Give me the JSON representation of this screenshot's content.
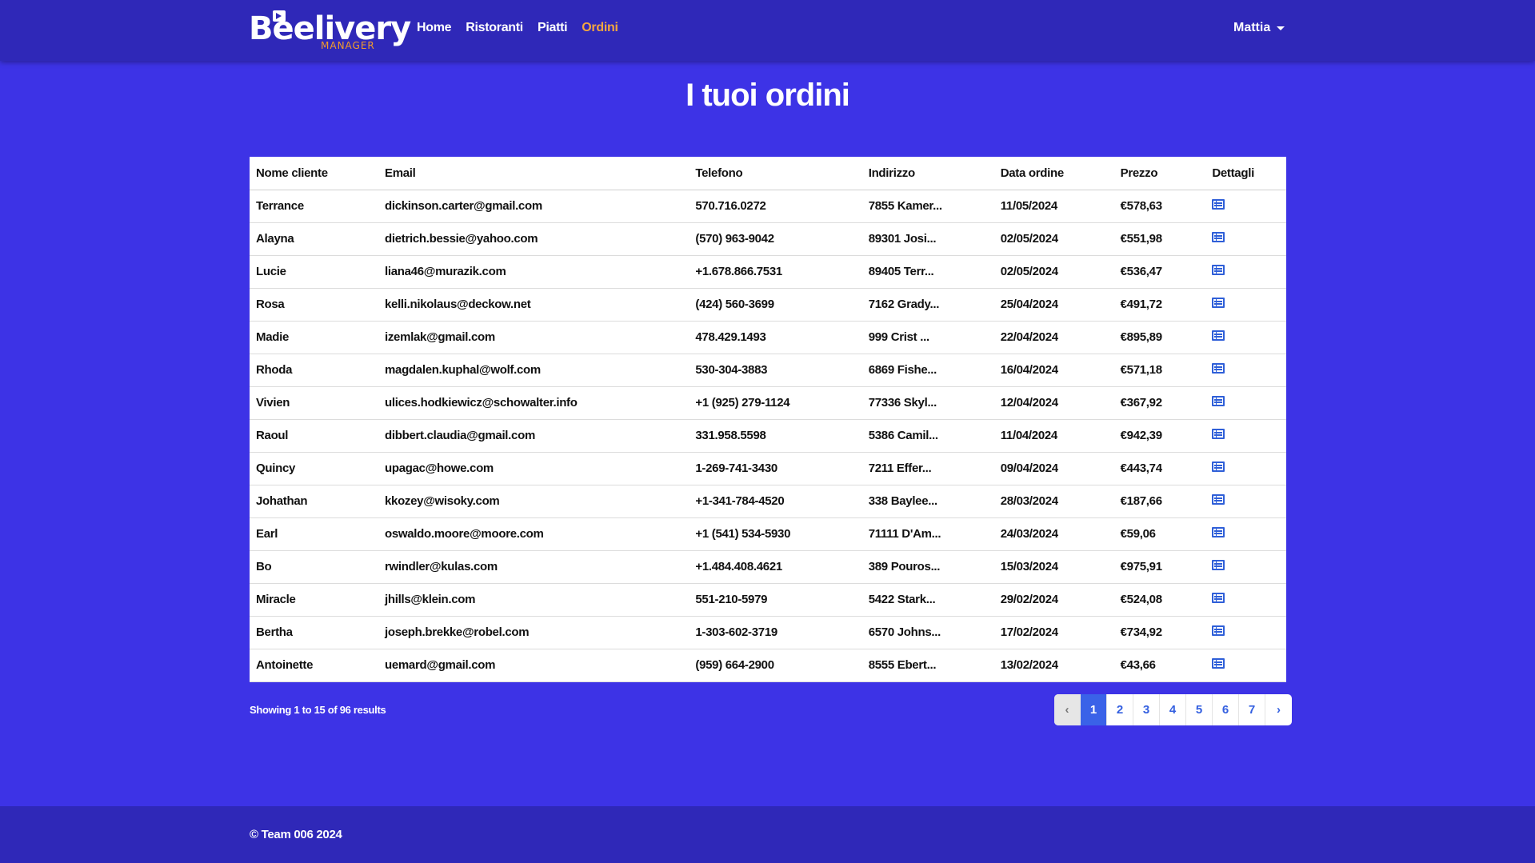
{
  "brand": {
    "name": "Beelivery",
    "subtitle": "MANAGER"
  },
  "nav": {
    "links": [
      {
        "label": "Home"
      },
      {
        "label": "Ristoranti"
      },
      {
        "label": "Piatti"
      },
      {
        "label": "Ordini",
        "active": true
      }
    ],
    "user": "Mattia"
  },
  "page": {
    "title": "I tuoi ordini"
  },
  "table": {
    "columns": [
      "Nome cliente",
      "Email",
      "Telefono",
      "Indirizzo",
      "Data ordine",
      "Prezzo",
      "Dettagli"
    ],
    "rows": [
      [
        "Terrance",
        "dickinson.carter@gmail.com",
        "570.716.0272",
        "7855 Kamer...",
        "11/05/2024",
        "€578,63"
      ],
      [
        "Alayna",
        "dietrich.bessie@yahoo.com",
        "(570) 963-9042",
        "89301 Josi...",
        "02/05/2024",
        "€551,98"
      ],
      [
        "Lucie",
        "liana46@murazik.com",
        "+1.678.866.7531",
        "89405 Terr...",
        "02/05/2024",
        "€536,47"
      ],
      [
        "Rosa",
        "kelli.nikolaus@deckow.net",
        "(424) 560-3699",
        "7162 Grady...",
        "25/04/2024",
        "€491,72"
      ],
      [
        "Madie",
        "izemlak@gmail.com",
        "478.429.1493",
        "999 Crist ...",
        "22/04/2024",
        "€895,89"
      ],
      [
        "Rhoda",
        "magdalen.kuphal@wolf.com",
        "530-304-3883",
        "6869 Fishe...",
        "16/04/2024",
        "€571,18"
      ],
      [
        "Vivien",
        "ulices.hodkiewicz@schowalter.info",
        "+1 (925) 279-1124",
        "77336 Skyl...",
        "12/04/2024",
        "€367,92"
      ],
      [
        "Raoul",
        "dibbert.claudia@gmail.com",
        "331.958.5598",
        "5386 Camil...",
        "11/04/2024",
        "€942,39"
      ],
      [
        "Quincy",
        "upagac@howe.com",
        "1-269-741-3430",
        "7211 Effer...",
        "09/04/2024",
        "€443,74"
      ],
      [
        "Johathan",
        "kkozey@wisoky.com",
        "+1-341-784-4520",
        "338 Baylee...",
        "28/03/2024",
        "€187,66"
      ],
      [
        "Earl",
        "oswaldo.moore@moore.com",
        "+1 (541) 534-5930",
        "71111 D'Am...",
        "24/03/2024",
        "€59,06"
      ],
      [
        "Bo",
        "rwindler@kulas.com",
        "+1.484.408.4621",
        "389 Pouros...",
        "15/03/2024",
        "€975,91"
      ],
      [
        "Miracle",
        "jhills@klein.com",
        "551-210-5979",
        "5422 Stark...",
        "29/02/2024",
        "€524,08"
      ],
      [
        "Bertha",
        "joseph.brekke@robel.com",
        "1-303-602-3719",
        "6570 Johns...",
        "17/02/2024",
        "€734,92"
      ],
      [
        "Antoinette",
        "uemard@gmail.com",
        "(959) 664-2900",
        "8555 Ebert...",
        "13/02/2024",
        "€43,66"
      ]
    ],
    "detail_icon": "list-icon"
  },
  "pagination": {
    "showing": "Showing 1 to 15 of 96 results",
    "prev": "‹",
    "next": "›",
    "pages": [
      "1",
      "2",
      "3",
      "4",
      "5",
      "6",
      "7"
    ],
    "current": "1"
  },
  "footer": {
    "text": "© Team 006 2024"
  },
  "colors": {
    "page_bg": "#3d33e6",
    "navbar_bg": "#2f28b8",
    "active_link": "#f3a640",
    "accent_blue": "#3a62e8"
  }
}
